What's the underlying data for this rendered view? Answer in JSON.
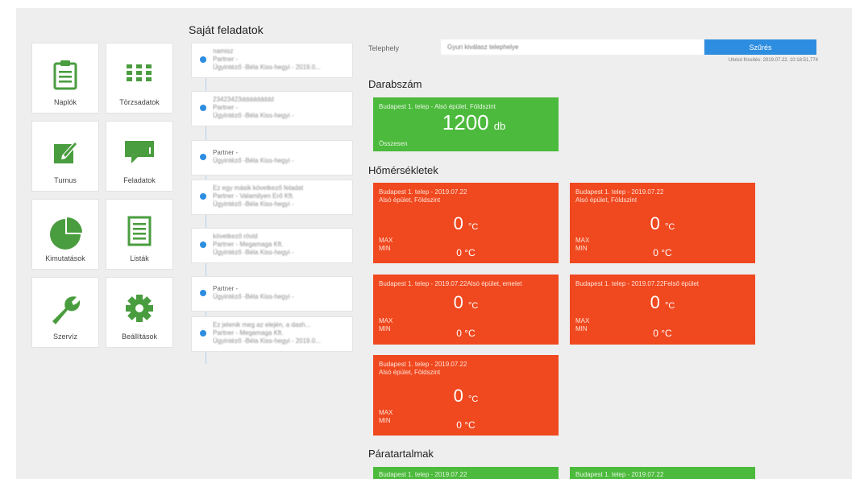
{
  "tiles": [
    {
      "label": "Naplók",
      "icon": "clipboard-icon"
    },
    {
      "label": "Törzsadatok",
      "icon": "grid-icon"
    },
    {
      "label": "Turnus",
      "icon": "edit-icon"
    },
    {
      "label": "Feladatok",
      "icon": "chat-icon"
    },
    {
      "label": "Kimutatások",
      "icon": "pie-chart-icon"
    },
    {
      "label": "Listák",
      "icon": "list-icon"
    },
    {
      "label": "Szervíz",
      "icon": "wrench-icon"
    },
    {
      "label": "Beállítások",
      "icon": "gear-icon"
    }
  ],
  "tasks_title": "Saját feladatok",
  "tasks": [
    {
      "title": "namisz",
      "partner": "Partner -",
      "assignee": "Ügyintéző -Béla Kiss-hegyi - 2019.0..."
    },
    {
      "title": "23423423ddddddddd",
      "partner": "Partner -",
      "assignee": "Ügyintéző -Béla Kiss-hegyi -"
    },
    {
      "title": "",
      "partner": "Partner -",
      "assignee": "Ügyintéző -Béla Kiss-hegyi -"
    },
    {
      "title": "Ez egy másik következő feladat",
      "partner": "Partner - Valamilyen Erő Kft.",
      "assignee": "Ügyintéző -Béla Kiss-hegyi -"
    },
    {
      "title": "következő rövid",
      "partner": "Partner - Megamaga Kft.",
      "assignee": "Ügyintéző -Béla Kiss-hegyi -"
    },
    {
      "title": "",
      "partner": "Partner -",
      "assignee": "Ügyintéző -Béla Kiss-hegyi -"
    },
    {
      "title": "Ez jelenik meg az elején, a dash...",
      "partner": "Partner - Megamaga Kft.",
      "assignee": "Ügyintéző -Béla Kiss-hegyi - 2019.0..."
    }
  ],
  "filter": {
    "label": "Telephely",
    "placeholder": "Gyuri kiválasz telephelye",
    "button": "Szűrés",
    "last_updated": "Utolsó frissítés: 2019.07.22. 10:18:51,774"
  },
  "count_section": {
    "title": "Darabszám",
    "card": {
      "head": "Budapest 1. telep - Alsó épület, Földszint",
      "value": "1200",
      "unit": "db",
      "footer": "Összesen"
    }
  },
  "temp_section": {
    "title": "Hőmérsékletek",
    "cards": [
      {
        "line1": "Budapest 1. telep - 2019.07.22",
        "line2": "Alsó épület, Földszint",
        "value": "0",
        "unit": "°C",
        "max_label": "MAX",
        "min_label": "MIN",
        "min_value": "0 °C"
      },
      {
        "line1": "Budapest 1. telep - 2019.07.22",
        "line2": "Alsó épület, Földszint",
        "value": "0",
        "unit": "°C",
        "max_label": "MAX",
        "min_label": "MIN",
        "min_value": "0 °C"
      },
      {
        "line1": "Budapest 1. telep - 2019.07.22Alsó épület, emelet",
        "line2": "",
        "value": "0",
        "unit": "°C",
        "max_label": "MAX",
        "min_label": "MIN",
        "min_value": "0 °C"
      },
      {
        "line1": "Budapest 1. telep - 2019.07.22Felső épület",
        "line2": "",
        "value": "0",
        "unit": "°C",
        "max_label": "MAX",
        "min_label": "MIN",
        "min_value": "0 °C"
      },
      {
        "line1": "Budapest 1. telep - 2019.07.22",
        "line2": "Alsó épület, Földszint",
        "value": "0",
        "unit": "°C",
        "max_label": "MAX",
        "min_label": "MIN",
        "min_value": "0 °C"
      }
    ]
  },
  "humidity_section": {
    "title": "Páratartalmak",
    "cards": [
      {
        "line1": "Budapest 1. telep - 2019.07.22"
      },
      {
        "line1": "Budapest 1. telep - 2019.07.22"
      }
    ]
  },
  "colors": {
    "green": "#4cba3c",
    "red": "#f0481f",
    "blue": "#2d8de0"
  }
}
